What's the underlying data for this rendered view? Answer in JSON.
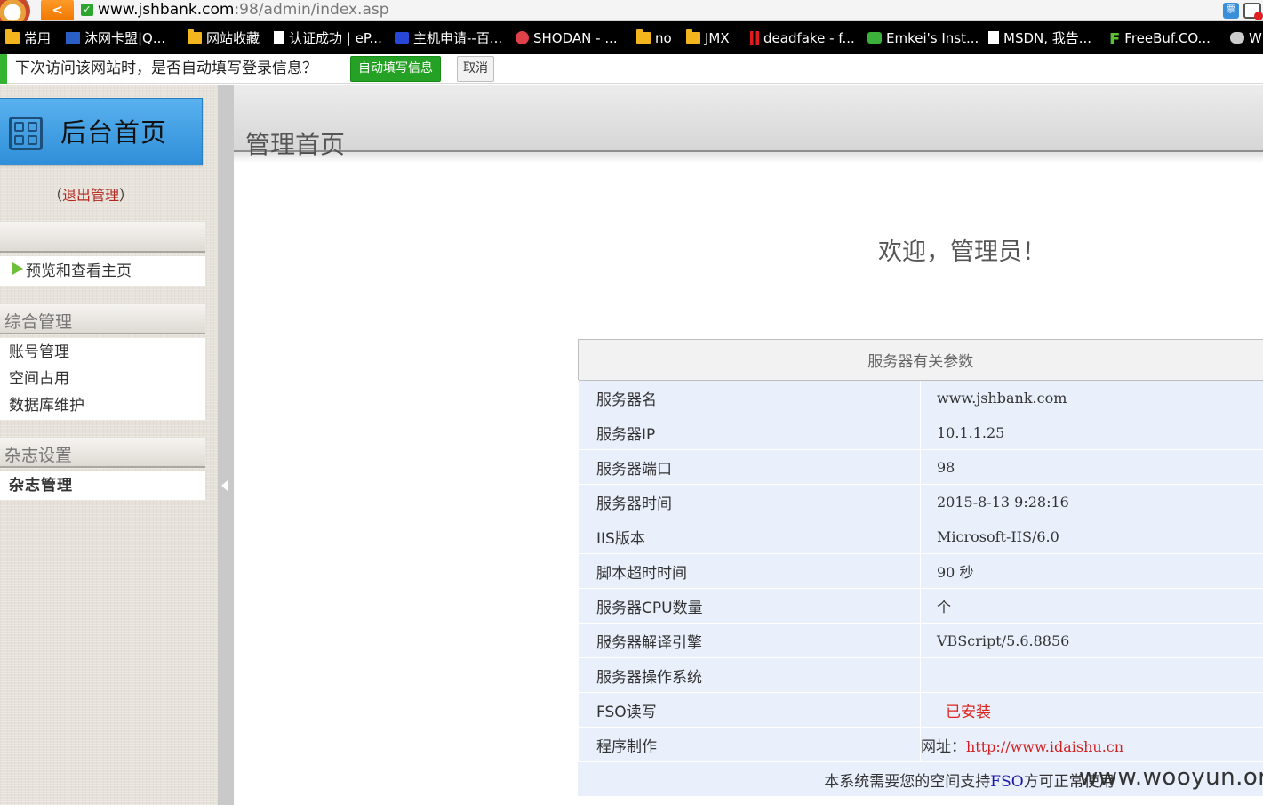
{
  "browser": {
    "back_label": "<",
    "url_host": "www.jshbank.com",
    "url_rest": ":98/admin/index.asp",
    "secure_glyph": "✓",
    "ext_label": "票"
  },
  "bookmarks": [
    {
      "label": "常用",
      "icon": "folder-icon"
    },
    {
      "label": "沐网卡盟|Q...",
      "icon": "site-icon"
    },
    {
      "label": "网站收藏",
      "icon": "folder-icon"
    },
    {
      "label": "认证成功 | eP...",
      "icon": "page-icon"
    },
    {
      "label": "主机申请--百...",
      "icon": "paw-icon"
    },
    {
      "label": "SHODAN - ...",
      "icon": "shodan-icon"
    },
    {
      "label": "no",
      "icon": "folder-icon"
    },
    {
      "label": "JMX",
      "icon": "folder-icon"
    },
    {
      "label": "deadfake - f...",
      "icon": "red-bars-icon"
    },
    {
      "label": "Emkei's Inst...",
      "icon": "green-icon"
    },
    {
      "label": "MSDN, 我告...",
      "icon": "page-icon"
    },
    {
      "label": "FreeBuf.CO...",
      "icon": "f-icon"
    },
    {
      "label": "W",
      "icon": "cloud-icon"
    }
  ],
  "autofill": {
    "prompt": "下次访问该网站时，是否自动填写登录信息？",
    "accept": "自动填写信息",
    "cancel": "取消"
  },
  "sidebar": {
    "home_title": "后台首页",
    "logout_open": "（",
    "logout": "退出管理",
    "logout_close": "）",
    "preview": "预览和查看主页",
    "section1_title": "综合管理",
    "section1_items": [
      "账号管理",
      "空间占用",
      "数据库维护"
    ],
    "section2_title": "杂志设置",
    "section2_items": [
      "杂志管理"
    ]
  },
  "main": {
    "title": "管理首页",
    "welcome": "欢迎，管理员！",
    "table_title": "服务器有关参数",
    "rows": [
      {
        "label": "服务器名",
        "value": "www.jshbank.com"
      },
      {
        "label": "服务器IP",
        "value": "10.1.1.25"
      },
      {
        "label": "服务器端口",
        "value": "98"
      },
      {
        "label": "服务器时间",
        "value": "2015-8-13 9:28:16"
      },
      {
        "label": "IIS版本",
        "value": "Microsoft-IIS/6.0"
      },
      {
        "label": "脚本超时时间",
        "value": "90 秒"
      },
      {
        "label": "服务器CPU数量",
        "value": "个"
      },
      {
        "label": "服务器解译引擎",
        "value": "VBScript/5.6.8856"
      },
      {
        "label": "服务器操作系统",
        "value": ""
      },
      {
        "label": "FSO读写",
        "value": "已安装"
      },
      {
        "label": "程序制作",
        "url_prefix": "网址：",
        "url": "http://www.idaishu.cn"
      }
    ],
    "note_before": "本系统需要您的空间支持",
    "note_fso": "FSO",
    "note_after": "方可正常使用"
  },
  "watermark": "www.wooyun.org",
  "colors": {
    "accent_green": "#35b331",
    "home_blue": "#3a9ae3",
    "link_red": "#b3261e",
    "table_row_bg": "#e9effb"
  }
}
